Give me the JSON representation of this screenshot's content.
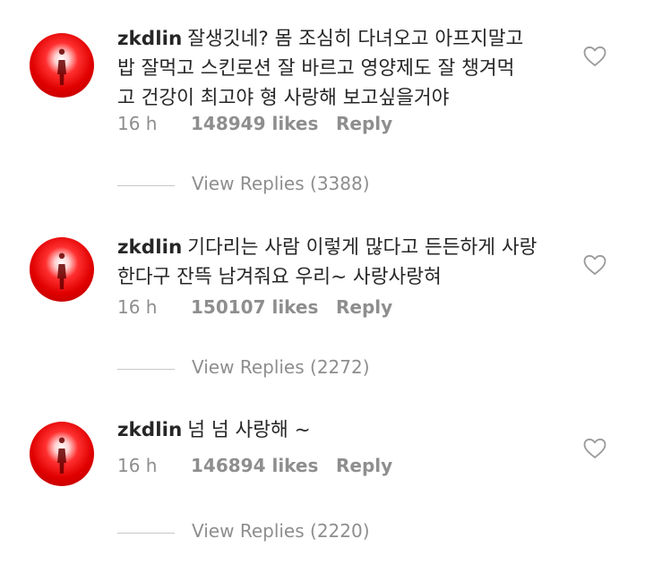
{
  "comments": [
    {
      "username": "zkdlin",
      "text_lines": [
        "잘생깃네? 몸 조심히 다녀오고 아프지말고",
        "밥 잘먹고 스킨로션 잘 바르고 영양제도 잘 챙겨먹",
        "고 건강이 최고야 형  사랑해 보고싶을거야"
      ],
      "time": "16 h",
      "likes": "148949 likes",
      "reply_label": "Reply",
      "view_replies": "View Replies (3388)",
      "avatar_icon": "profile-photo",
      "like_icon": "heart-outline-icon"
    },
    {
      "username": "zkdlin",
      "text_lines": [
        "기다리는 사람 이렇게 많다고 든든하게 사랑",
        "한다구 잔뜩 남겨줘요 우리~ 사랑사랑혀"
      ],
      "time": "16 h",
      "likes": "150107 likes",
      "reply_label": "Reply",
      "view_replies": "View Replies (2272)",
      "avatar_icon": "profile-photo",
      "like_icon": "heart-outline-icon"
    },
    {
      "username": "zkdlin",
      "text_lines": [
        "넘 넘 사랑해 ~"
      ],
      "time": "16 h",
      "likes": "146894 likes",
      "reply_label": "Reply",
      "view_replies": "View Replies (2220)",
      "avatar_icon": "profile-photo",
      "like_icon": "heart-outline-icon"
    }
  ],
  "colors": {
    "text": "#262626",
    "meta": "#8e8e8e",
    "avatar_red": "#e00000"
  }
}
